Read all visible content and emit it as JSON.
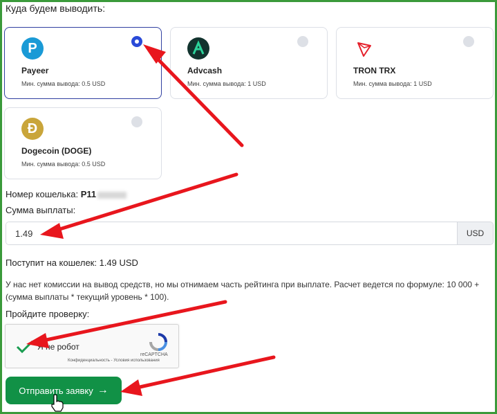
{
  "section_title": "Куда будем выводить:",
  "methods": [
    {
      "name": "Payeer",
      "min": "Мин. сумма вывода: 0.5 USD",
      "selected": true,
      "icon": "payeer-icon"
    },
    {
      "name": "Advcash",
      "min": "Мин. сумма вывода: 1 USD",
      "selected": false,
      "icon": "advcash-icon"
    },
    {
      "name": "TRON TRX",
      "min": "Мин. сумма вывода: 1 USD",
      "selected": false,
      "icon": "tron-icon"
    },
    {
      "name": "Dogecoin (DOGE)",
      "min": "Мин. сумма вывода: 0.5 USD",
      "selected": false,
      "icon": "dogecoin-icon"
    }
  ],
  "wallet": {
    "label": "Номер кошелька:",
    "value": "P11"
  },
  "amount": {
    "label": "Сумма выплаты:",
    "value": "1.49",
    "currency": "USD"
  },
  "receive": {
    "text": "Поступит на кошелек: 1.49 USD"
  },
  "info": {
    "text": "У нас нет комиссии на вывод средств, но мы отнимаем часть рейтинга при выплате. Расчет ведется по формуле: 10 000 + (сумма выплаты * текущий уровень * 100)."
  },
  "verify": {
    "label": "Пройдите проверку:"
  },
  "captcha": {
    "label": "Я не робот",
    "brand": "reCAPTCHA",
    "links": "Конфиденциальность - Условия использования",
    "checked": true
  },
  "submit": {
    "label": "Отправить заявку",
    "arrow": "→"
  },
  "colors": {
    "accent": "#119146",
    "selected_radio": "#2a4ad8",
    "annotation_arrow": "#e8161d",
    "frame": "#3a9a3a"
  }
}
